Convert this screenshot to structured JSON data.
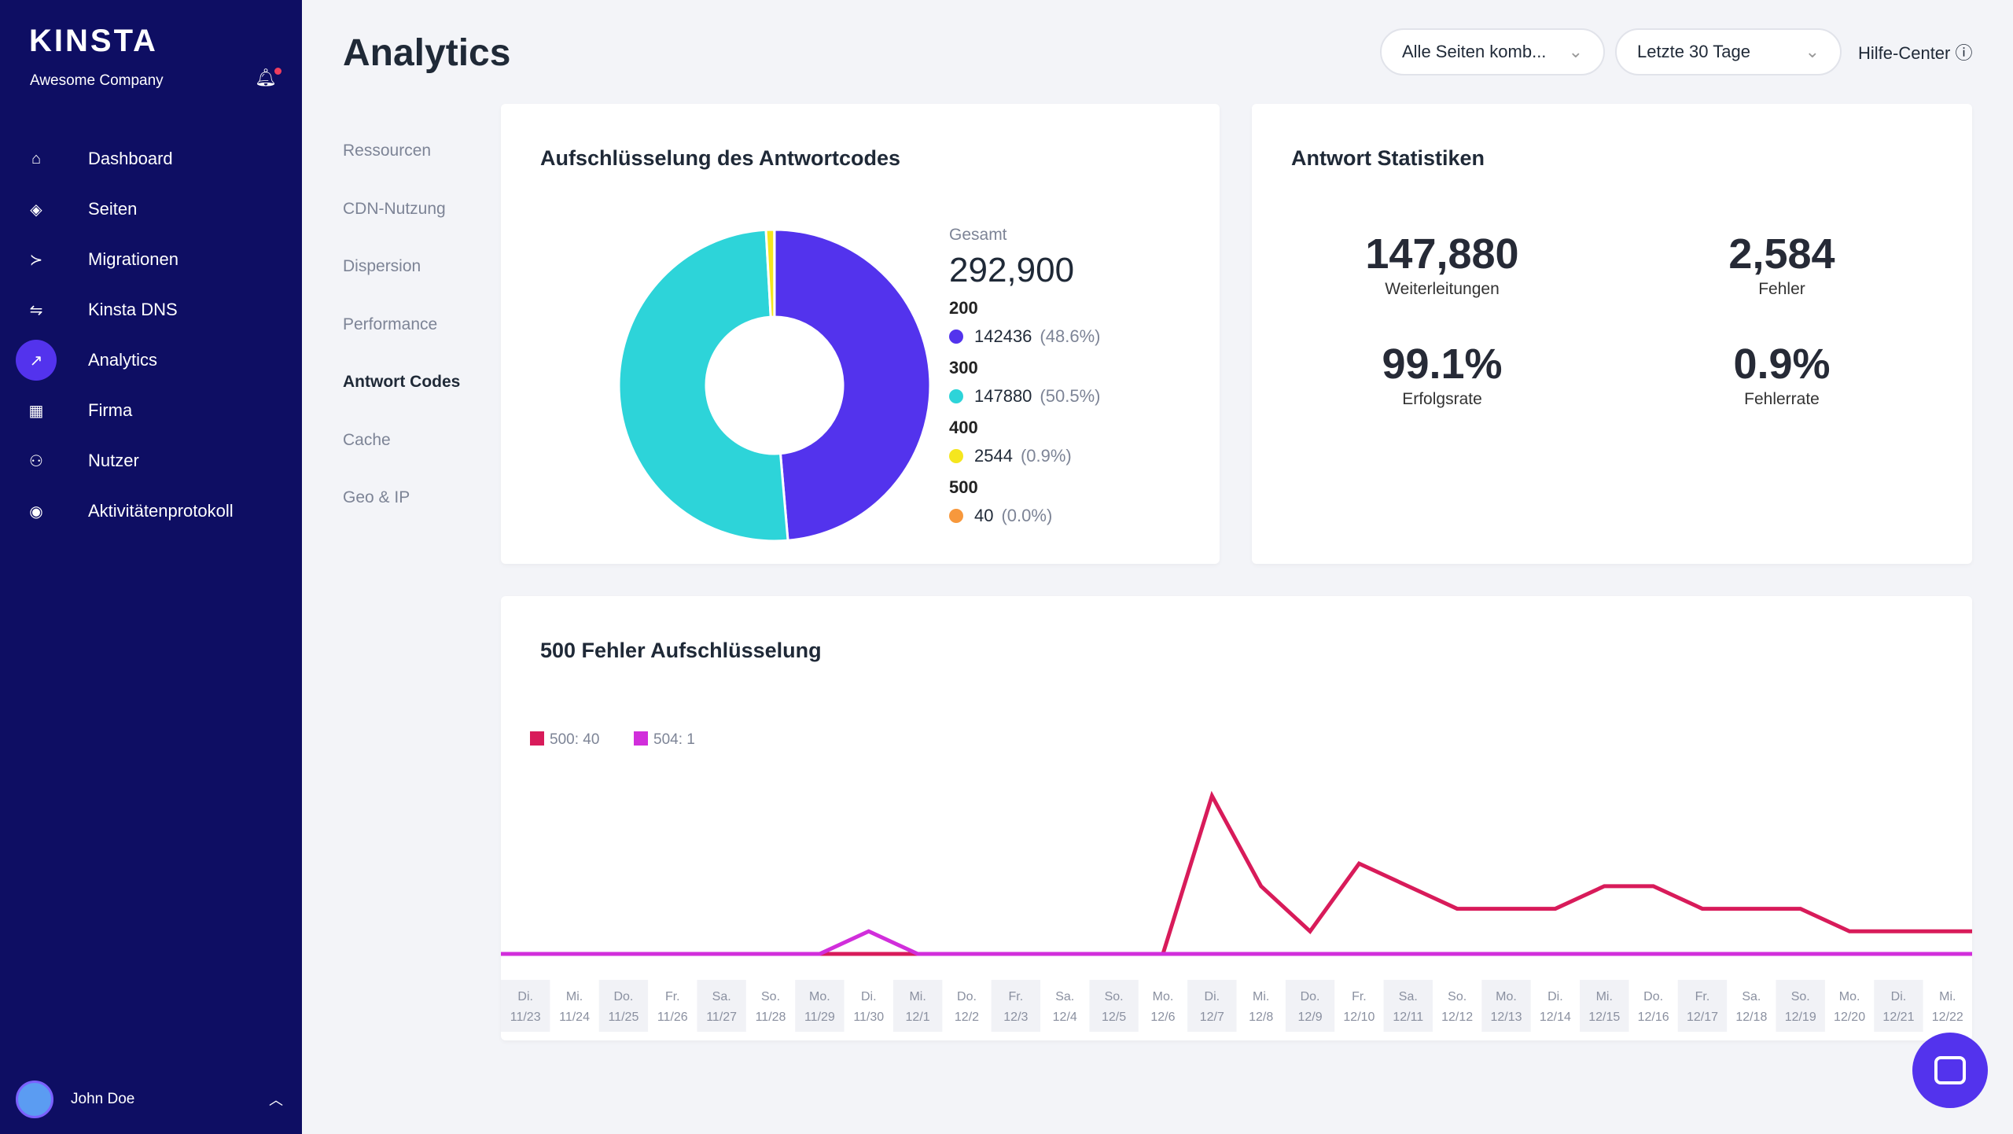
{
  "sidebar": {
    "logo": "KINSTA",
    "company": "Awesome Company",
    "items": [
      {
        "label": "Dashboard",
        "icon": "⌂",
        "name": "home"
      },
      {
        "label": "Seiten",
        "icon": "◈",
        "name": "layers"
      },
      {
        "label": "Migrationen",
        "icon": "≻",
        "name": "migration"
      },
      {
        "label": "Kinsta DNS",
        "icon": "⇋",
        "name": "dns"
      },
      {
        "label": "Analytics",
        "icon": "↗",
        "name": "analytics"
      },
      {
        "label": "Firma",
        "icon": "▦",
        "name": "building"
      },
      {
        "label": "Nutzer",
        "icon": "⚇",
        "name": "user-add"
      },
      {
        "label": "Aktivitätenprotokoll",
        "icon": "◉",
        "name": "eye"
      }
    ],
    "active": "Analytics",
    "user": "John Doe"
  },
  "header": {
    "title": "Analytics",
    "site_select": "Alle Seiten komb...",
    "range_select": "Letzte 30 Tage",
    "help": "Hilfe-Center"
  },
  "subnav": [
    "Ressourcen",
    "CDN-Nutzung",
    "Dispersion",
    "Performance",
    "Antwort Codes",
    "Cache",
    "Geo & IP"
  ],
  "subnav_active": "Antwort Codes",
  "colors": {
    "accent": "#5333ed",
    "c200": "#5333ed",
    "c300": "#2dd4d9",
    "c400": "#f5e61e",
    "c500": "#f7983c",
    "s500": "#d81b5a",
    "s504": "#d12edb"
  },
  "breakdown": {
    "title": "Aufschlüsselung des Antwortcodes",
    "total_label": "Gesamt",
    "total": "292,900",
    "codes": [
      {
        "code": "200",
        "count": "142436",
        "pct": "(48.6%)",
        "value": 142436
      },
      {
        "code": "300",
        "count": "147880",
        "pct": "(50.5%)",
        "value": 147880
      },
      {
        "code": "400",
        "count": "2544",
        "pct": "(0.9%)",
        "value": 2544
      },
      {
        "code": "500",
        "count": "40",
        "pct": "(0.0%)",
        "value": 40
      }
    ]
  },
  "stats": {
    "title": "Antwort Statistiken",
    "items": [
      {
        "value": "147,880",
        "label": "Weiterleitungen"
      },
      {
        "value": "2,584",
        "label": "Fehler"
      },
      {
        "value": "99.1%",
        "label": "Erfolgsrate"
      },
      {
        "value": "0.9%",
        "label": "Fehlerrate"
      }
    ]
  },
  "chart_data": {
    "type": "line",
    "title": "500 Fehler Aufschlüsselung",
    "categories": [
      [
        "Di.",
        "11/23"
      ],
      [
        "Mi.",
        "11/24"
      ],
      [
        "Do.",
        "11/25"
      ],
      [
        "Fr.",
        "11/26"
      ],
      [
        "Sa.",
        "11/27"
      ],
      [
        "So.",
        "11/28"
      ],
      [
        "Mo.",
        "11/29"
      ],
      [
        "Di.",
        "11/30"
      ],
      [
        "Mi.",
        "12/1"
      ],
      [
        "Do.",
        "12/2"
      ],
      [
        "Fr.",
        "12/3"
      ],
      [
        "Sa.",
        "12/4"
      ],
      [
        "So.",
        "12/5"
      ],
      [
        "Mo.",
        "12/6"
      ],
      [
        "Di.",
        "12/7"
      ],
      [
        "Mi.",
        "12/8"
      ],
      [
        "Do.",
        "12/9"
      ],
      [
        "Fr.",
        "12/10"
      ],
      [
        "Sa.",
        "12/11"
      ],
      [
        "So.",
        "12/12"
      ],
      [
        "Mo.",
        "12/13"
      ],
      [
        "Di.",
        "12/14"
      ],
      [
        "Mi.",
        "12/15"
      ],
      [
        "Do.",
        "12/16"
      ],
      [
        "Fr.",
        "12/17"
      ],
      [
        "Sa.",
        "12/18"
      ],
      [
        "So.",
        "12/19"
      ],
      [
        "Mo.",
        "12/20"
      ],
      [
        "Di.",
        "12/21"
      ],
      [
        "Mi.",
        "12/22"
      ]
    ],
    "series": [
      {
        "name": "500: 40",
        "color": "#d81b5a",
        "values": [
          0,
          0,
          0,
          0,
          0,
          0,
          0,
          0,
          0,
          0,
          0,
          0,
          0,
          0,
          7,
          3,
          1,
          4,
          3,
          2,
          2,
          2,
          3,
          3,
          2,
          2,
          2,
          1,
          1,
          1
        ]
      },
      {
        "name": "504: 1",
        "color": "#d12edb",
        "values": [
          0,
          0,
          0,
          0,
          0,
          0,
          0,
          1,
          0,
          0,
          0,
          0,
          0,
          0,
          0,
          0,
          0,
          0,
          0,
          0,
          0,
          0,
          0,
          0,
          0,
          0,
          0,
          0,
          0,
          0
        ]
      }
    ],
    "ylim": [
      0,
      7
    ],
    "grid": false,
    "legend": "top-left"
  }
}
